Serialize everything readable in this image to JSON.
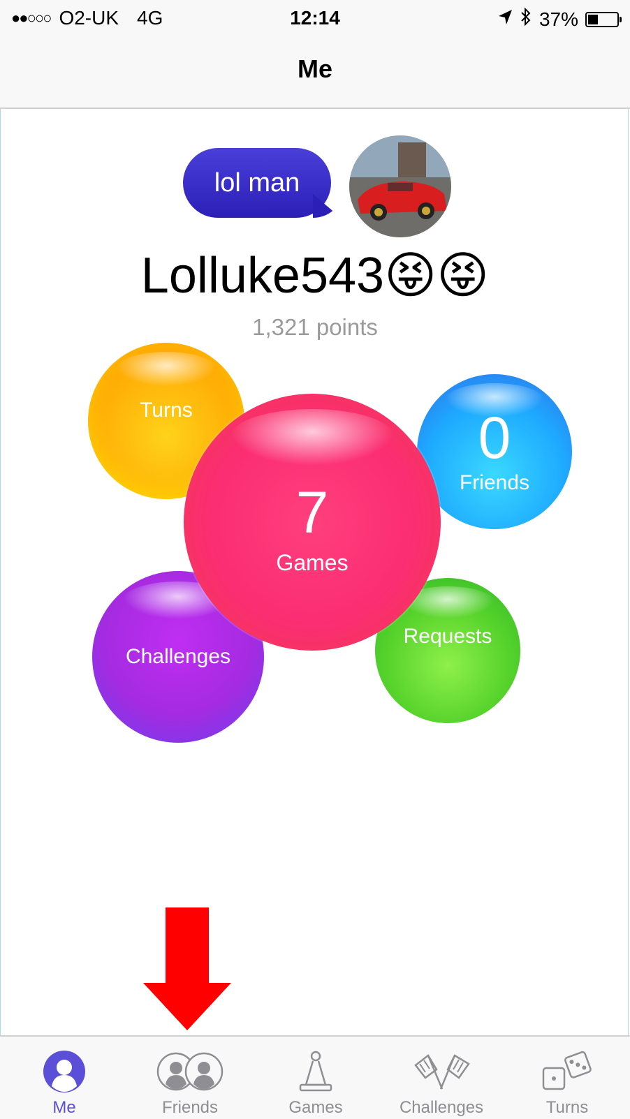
{
  "status_bar": {
    "carrier": "O2-UK",
    "network": "4G",
    "time": "12:14",
    "battery_percent": "37%",
    "signal_bars": 2,
    "signal_total": 5,
    "battery_level": 0.37,
    "icons": [
      "location-arrow-icon",
      "bluetooth-icon",
      "battery-icon"
    ]
  },
  "nav": {
    "title": "Me"
  },
  "profile": {
    "status_message": "lol man",
    "username": "Lolluke543😝😝",
    "points": "1,321 points",
    "bubble_color": "#2b1fb8"
  },
  "bubbles": {
    "turns": {
      "label": "Turns",
      "color": "#ffb007"
    },
    "friends": {
      "count": "0",
      "label": "Friends",
      "color": "#1eaaff"
    },
    "games": {
      "count": "7",
      "label": "Games",
      "color": "#fb2d73"
    },
    "challenges": {
      "label": "Challenges",
      "color": "#a52be0"
    },
    "requests": {
      "label": "Requests",
      "color": "#55d22b"
    }
  },
  "annotation": {
    "arrow_color": "#ff0000"
  },
  "tab_bar": {
    "accent": "#5a4fd6",
    "inactive": "#8e8e93",
    "tabs": [
      {
        "label": "Me",
        "icon": "person-icon",
        "active": true
      },
      {
        "label": "Friends",
        "icon": "friends-icon",
        "active": false
      },
      {
        "label": "Games",
        "icon": "game-piece-icon",
        "active": false
      },
      {
        "label": "Challenges",
        "icon": "flags-icon",
        "active": false
      },
      {
        "label": "Turns",
        "icon": "dice-icon",
        "active": false
      }
    ]
  }
}
